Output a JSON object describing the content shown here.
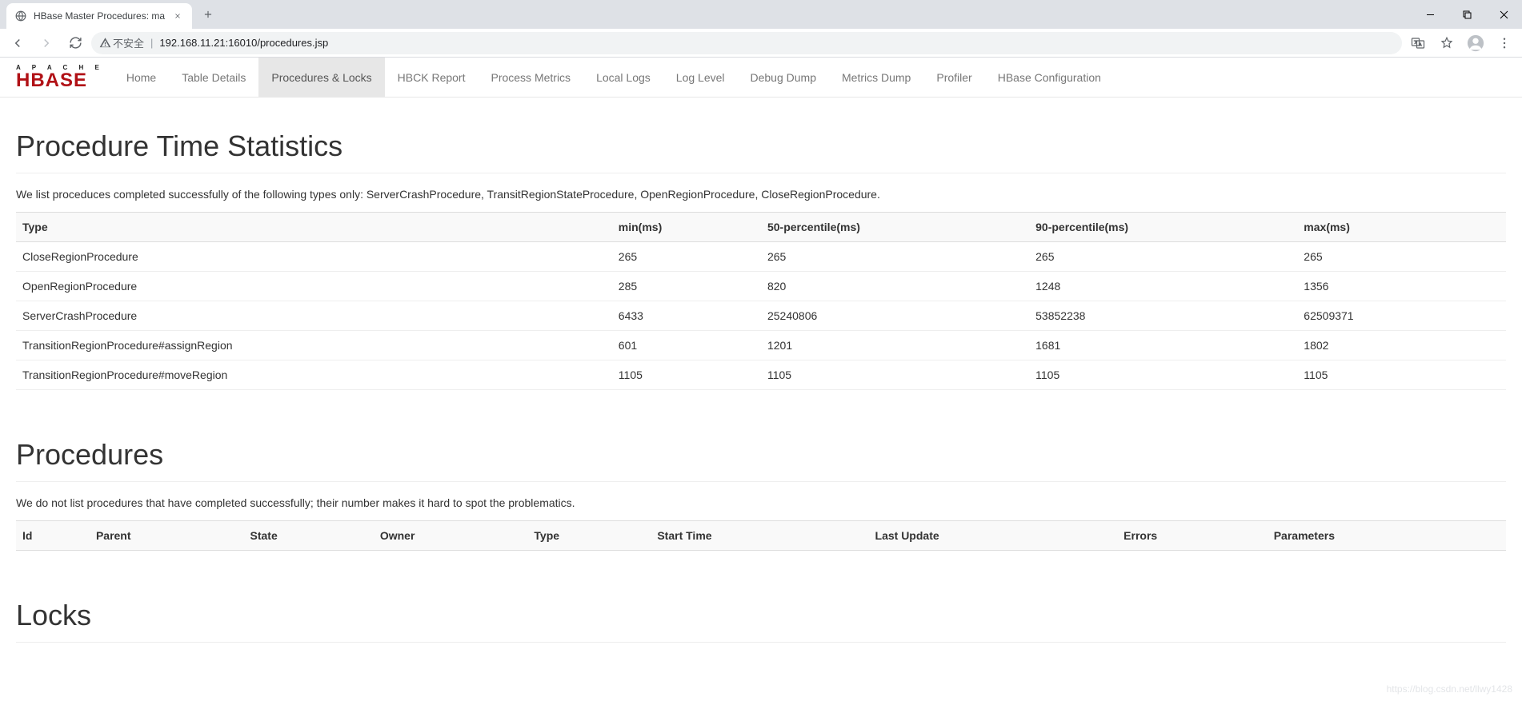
{
  "browser": {
    "tab_title": "HBase Master Procedures: ma",
    "security_label": "不安全",
    "url": "192.168.11.21:16010/procedures.jsp"
  },
  "nav": {
    "items": [
      {
        "label": "Home",
        "active": false
      },
      {
        "label": "Table Details",
        "active": false
      },
      {
        "label": "Procedures & Locks",
        "active": true
      },
      {
        "label": "HBCK Report",
        "active": false
      },
      {
        "label": "Process Metrics",
        "active": false
      },
      {
        "label": "Local Logs",
        "active": false
      },
      {
        "label": "Log Level",
        "active": false
      },
      {
        "label": "Debug Dump",
        "active": false
      },
      {
        "label": "Metrics Dump",
        "active": false
      },
      {
        "label": "Profiler",
        "active": false
      },
      {
        "label": "HBase Configuration",
        "active": false
      }
    ],
    "brand_top": "A P A C H E",
    "brand_main": "HBASE"
  },
  "sections": {
    "stats": {
      "title": "Procedure Time Statistics",
      "intro": "We list proceduces completed successfully of the following types only: ServerCrashProcedure, TransitRegionStateProcedure, OpenRegionProcedure, CloseRegionProcedure.",
      "headers": [
        "Type",
        "min(ms)",
        "50-percentile(ms)",
        "90-percentile(ms)",
        "max(ms)"
      ],
      "rows": [
        {
          "c": [
            "CloseRegionProcedure",
            "265",
            "265",
            "265",
            "265"
          ]
        },
        {
          "c": [
            "OpenRegionProcedure",
            "285",
            "820",
            "1248",
            "1356"
          ]
        },
        {
          "c": [
            "ServerCrashProcedure",
            "6433",
            "25240806",
            "53852238",
            "62509371"
          ]
        },
        {
          "c": [
            "TransitionRegionProcedure#assignRegion",
            "601",
            "1201",
            "1681",
            "1802"
          ]
        },
        {
          "c": [
            "TransitionRegionProcedure#moveRegion",
            "1105",
            "1105",
            "1105",
            "1105"
          ]
        }
      ]
    },
    "procedures": {
      "title": "Procedures",
      "intro": "We do not list procedures that have completed successfully; their number makes it hard to spot the problematics.",
      "headers": [
        "Id",
        "Parent",
        "State",
        "Owner",
        "Type",
        "Start Time",
        "Last Update",
        "Errors",
        "Parameters"
      ]
    },
    "locks": {
      "title": "Locks"
    }
  },
  "watermark": "https://blog.csdn.net/llwy1428"
}
